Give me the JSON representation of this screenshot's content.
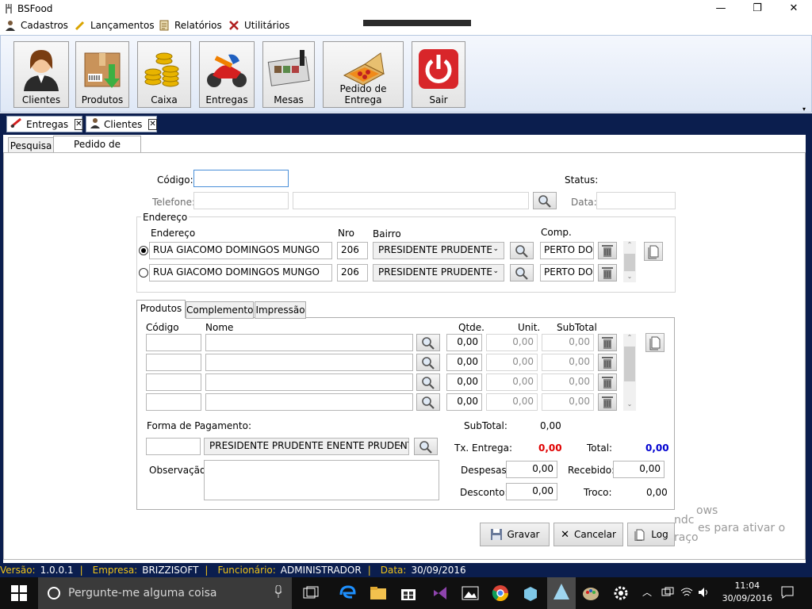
{
  "window": {
    "title": "BSFood",
    "minimize": "—",
    "maximize": "❐",
    "close": "✕"
  },
  "menu": {
    "items": [
      "Cadastros",
      "Lançamentos",
      "Relatórios",
      "Utilitários"
    ]
  },
  "toolbar": {
    "buttons": [
      "Clientes",
      "Produtos",
      "Caixa",
      "Entregas",
      "Mesas",
      "Pedido de Entrega",
      "Sair"
    ]
  },
  "doc_tabs": {
    "tabs": [
      "Entregas",
      "Clientes"
    ]
  },
  "sub_tabs": {
    "tabs": [
      "Pesquisa",
      "Pedido de Entrega"
    ]
  },
  "form": {
    "codigo_label": "Código:",
    "codigo_value": "",
    "status_label": "Status:",
    "telefone_label": "Telefone:",
    "data_label": "Data:",
    "endereco_group": "Endereço",
    "columns": {
      "endereco": "Endereço",
      "nro": "Nro",
      "bairro": "Bairro",
      "comp": "Comp."
    },
    "addresses": [
      {
        "selected": true,
        "endereco": "RUA GIACOMO DOMINGOS MUNGO",
        "nro": "206",
        "bairro": "PRESIDENTE PRUDENTE",
        "comp": "PERTO DOE"
      },
      {
        "selected": false,
        "endereco": "RUA GIACOMO DOMINGOS MUNGO",
        "nro": "206",
        "bairro": "PRESIDENTE PRUDENTE",
        "comp": "PERTO DOE"
      }
    ]
  },
  "product_tabs": {
    "tabs": [
      "Produtos",
      "Complemento",
      "Impressão"
    ]
  },
  "products": {
    "headers": {
      "codigo": "Código",
      "nome": "Nome",
      "qtde": "Qtde.",
      "unit": "Unit.",
      "subtotal": "SubTotal"
    },
    "rows": [
      {
        "codigo": "",
        "nome": "",
        "qtde": "0,00",
        "unit": "0,00",
        "subtotal": "0,00"
      },
      {
        "codigo": "",
        "nome": "",
        "qtde": "0,00",
        "unit": "0,00",
        "subtotal": "0,00"
      },
      {
        "codigo": "",
        "nome": "",
        "qtde": "0,00",
        "unit": "0,00",
        "subtotal": "0,00"
      },
      {
        "codigo": "",
        "nome": "",
        "qtde": "0,00",
        "unit": "0,00",
        "subtotal": "0,00"
      }
    ]
  },
  "payment": {
    "forma_label": "Forma de Pagamento:",
    "forma_value": "PRESIDENTE PRUDENTE ENENTE PRUDENTE",
    "observacao_label": "Observação:",
    "subtotal_label": "SubTotal:",
    "subtotal_value": "0,00",
    "tx_entrega_label": "Tx. Entrega:",
    "tx_entrega_value": "0,00",
    "total_label": "Total:",
    "total_value": "0,00",
    "despesas_label": "Despesas:",
    "despesas_value": "0,00",
    "recebido_label": "Recebido:",
    "recebido_value": "0,00",
    "desconto_label": "Desconto:",
    "desconto_value": "0,00",
    "troco_label": "Troco:",
    "troco_value": "0,00"
  },
  "actions": {
    "gravar": "Gravar",
    "cancelar": "Cancelar",
    "log": "Log"
  },
  "watermark": {
    "line1": "ows",
    "line2": "ndc",
    "line3": "es para ativar o",
    "line4": "raço"
  },
  "statusbar": {
    "versao_label": "Versão:",
    "versao": "1.0.0.1",
    "empresa_label": "Empresa:",
    "empresa": "BRIZZISOFT",
    "funcionario_label": "Funcionário:",
    "funcionario": "ADMINISTRADOR",
    "data_label": "Data:",
    "data": "30/09/2016"
  },
  "taskbar": {
    "search_placeholder": "Pergunte-me alguma coisa",
    "time": "11:04",
    "date": "30/09/2016"
  },
  "colors": {
    "tx_entrega": "#e00000",
    "total": "#0000d0",
    "status_key": "#f0c419",
    "dark_bg": "#0b1e4e"
  }
}
